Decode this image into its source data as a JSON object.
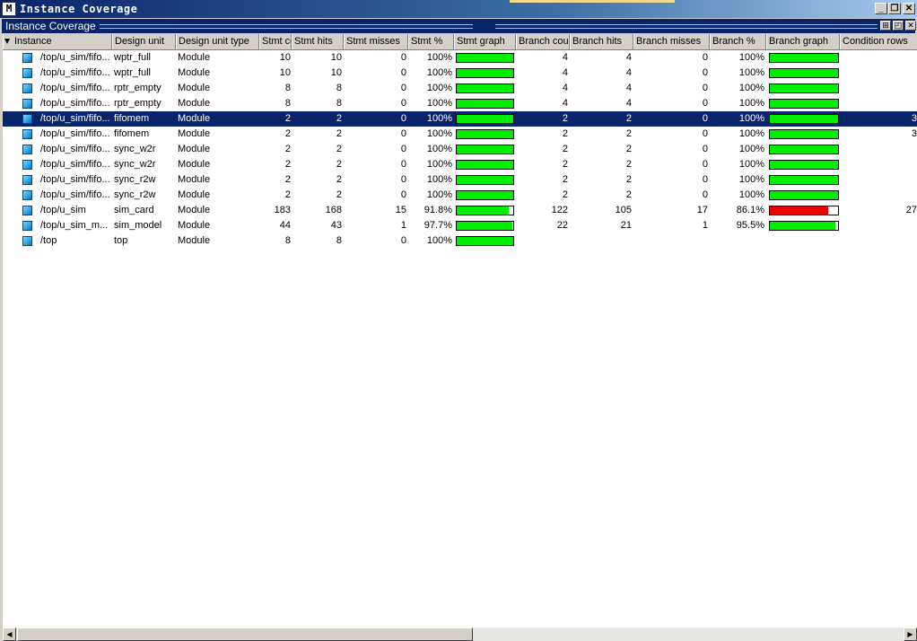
{
  "window": {
    "title": "Instance Coverage",
    "icon_text": "M",
    "minimize": "_",
    "restore": "❐",
    "close": "✕"
  },
  "panel": {
    "title": "Instance Coverage",
    "btn_float": "⊞",
    "btn_undock": "◰",
    "btn_close": "✕"
  },
  "columns": [
    "Instance",
    "Design unit",
    "Design unit type",
    "Stmt count",
    "Stmt hits",
    "Stmt misses",
    "Stmt %",
    "Stmt graph",
    "Branch count",
    "Branch hits",
    "Branch misses",
    "Branch %",
    "Branch graph",
    "Condition rows"
  ],
  "colors": {
    "pass": "#00ee00",
    "fail": "#ee0000",
    "selected_bg": "#0a246a",
    "title_bar": "#0a246a"
  },
  "rows": [
    {
      "instance": "/top/u_sim/fifo...",
      "unit": "wptr_full",
      "type": "Module",
      "stmt_count": "10",
      "stmt_hits": "10",
      "stmt_misses": "0",
      "stmt_pct": "100%",
      "stmt_frac": 1.0,
      "br_count": "4",
      "br_hits": "4",
      "br_misses": "0",
      "br_pct": "100%",
      "br_frac": 1.0,
      "cond_rows": ""
    },
    {
      "instance": "/top/u_sim/fifo...",
      "unit": "wptr_full",
      "type": "Module",
      "stmt_count": "10",
      "stmt_hits": "10",
      "stmt_misses": "0",
      "stmt_pct": "100%",
      "stmt_frac": 1.0,
      "br_count": "4",
      "br_hits": "4",
      "br_misses": "0",
      "br_pct": "100%",
      "br_frac": 1.0,
      "cond_rows": ""
    },
    {
      "instance": "/top/u_sim/fifo...",
      "unit": "rptr_empty",
      "type": "Module",
      "stmt_count": "8",
      "stmt_hits": "8",
      "stmt_misses": "0",
      "stmt_pct": "100%",
      "stmt_frac": 1.0,
      "br_count": "4",
      "br_hits": "4",
      "br_misses": "0",
      "br_pct": "100%",
      "br_frac": 1.0,
      "cond_rows": ""
    },
    {
      "instance": "/top/u_sim/fifo...",
      "unit": "rptr_empty",
      "type": "Module",
      "stmt_count": "8",
      "stmt_hits": "8",
      "stmt_misses": "0",
      "stmt_pct": "100%",
      "stmt_frac": 1.0,
      "br_count": "4",
      "br_hits": "4",
      "br_misses": "0",
      "br_pct": "100%",
      "br_frac": 1.0,
      "cond_rows": ""
    },
    {
      "instance": "/top/u_sim/fifo...",
      "unit": "fifomem",
      "type": "Module",
      "stmt_count": "2",
      "stmt_hits": "2",
      "stmt_misses": "0",
      "stmt_pct": "100%",
      "stmt_frac": 1.0,
      "br_count": "2",
      "br_hits": "2",
      "br_misses": "0",
      "br_pct": "100%",
      "br_frac": 1.0,
      "cond_rows": "3",
      "selected": true
    },
    {
      "instance": "/top/u_sim/fifo...",
      "unit": "fifomem",
      "type": "Module",
      "stmt_count": "2",
      "stmt_hits": "2",
      "stmt_misses": "0",
      "stmt_pct": "100%",
      "stmt_frac": 1.0,
      "br_count": "2",
      "br_hits": "2",
      "br_misses": "0",
      "br_pct": "100%",
      "br_frac": 1.0,
      "cond_rows": "3"
    },
    {
      "instance": "/top/u_sim/fifo...",
      "unit": "sync_w2r",
      "type": "Module",
      "stmt_count": "2",
      "stmt_hits": "2",
      "stmt_misses": "0",
      "stmt_pct": "100%",
      "stmt_frac": 1.0,
      "br_count": "2",
      "br_hits": "2",
      "br_misses": "0",
      "br_pct": "100%",
      "br_frac": 1.0,
      "cond_rows": ""
    },
    {
      "instance": "/top/u_sim/fifo...",
      "unit": "sync_w2r",
      "type": "Module",
      "stmt_count": "2",
      "stmt_hits": "2",
      "stmt_misses": "0",
      "stmt_pct": "100%",
      "stmt_frac": 1.0,
      "br_count": "2",
      "br_hits": "2",
      "br_misses": "0",
      "br_pct": "100%",
      "br_frac": 1.0,
      "cond_rows": ""
    },
    {
      "instance": "/top/u_sim/fifo...",
      "unit": "sync_r2w",
      "type": "Module",
      "stmt_count": "2",
      "stmt_hits": "2",
      "stmt_misses": "0",
      "stmt_pct": "100%",
      "stmt_frac": 1.0,
      "br_count": "2",
      "br_hits": "2",
      "br_misses": "0",
      "br_pct": "100%",
      "br_frac": 1.0,
      "cond_rows": ""
    },
    {
      "instance": "/top/u_sim/fifo...",
      "unit": "sync_r2w",
      "type": "Module",
      "stmt_count": "2",
      "stmt_hits": "2",
      "stmt_misses": "0",
      "stmt_pct": "100%",
      "stmt_frac": 1.0,
      "br_count": "2",
      "br_hits": "2",
      "br_misses": "0",
      "br_pct": "100%",
      "br_frac": 1.0,
      "cond_rows": ""
    },
    {
      "instance": "/top/u_sim",
      "unit": "sim_card",
      "type": "Module",
      "stmt_count": "183",
      "stmt_hits": "168",
      "stmt_misses": "15",
      "stmt_pct": "91.8%",
      "stmt_frac": 0.918,
      "br_count": "122",
      "br_hits": "105",
      "br_misses": "17",
      "br_pct": "86.1%",
      "br_frac": 0.861,
      "cond_rows": "27"
    },
    {
      "instance": "/top/u_sim_m...",
      "unit": "sim_model",
      "type": "Module",
      "stmt_count": "44",
      "stmt_hits": "43",
      "stmt_misses": "1",
      "stmt_pct": "97.7%",
      "stmt_frac": 0.977,
      "br_count": "22",
      "br_hits": "21",
      "br_misses": "1",
      "br_pct": "95.5%",
      "br_frac": 0.955,
      "cond_rows": ""
    },
    {
      "instance": "/top",
      "unit": "top",
      "type": "Module",
      "stmt_count": "8",
      "stmt_hits": "8",
      "stmt_misses": "0",
      "stmt_pct": "100%",
      "stmt_frac": 1.0,
      "br_count": "",
      "br_hits": "",
      "br_misses": "",
      "br_pct": "",
      "br_frac": null,
      "cond_rows": ""
    }
  ],
  "scrollbar": {
    "left_arrow": "◀",
    "right_arrow": "▶"
  }
}
